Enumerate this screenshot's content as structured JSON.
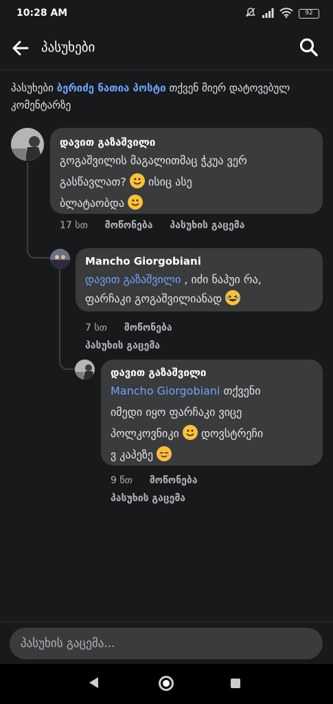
{
  "status_bar": {
    "time": "10:28 AM",
    "battery": "92"
  },
  "header": {
    "title": "პასუხები"
  },
  "intro": {
    "prefix": "პასუხები ",
    "link": "ბერიძე ნათია პოსტი",
    "suffix": " თქვენ მიერ დატოვებულ კომენტარზე"
  },
  "comments": [
    {
      "author": "დავით გაზაშვილი",
      "line1": "გოგაშვილის მაგალითმაც ჭკუა ვერ",
      "line2": "გასწავლათ?",
      "line2b": " ისიც ასე",
      "line3": "ბლატაობდა",
      "time": "17 სთ",
      "like": "მოწონება",
      "reply": "პასუხის გაცემა"
    },
    {
      "author": "Mancho Giorgobiani",
      "mention": "დავით გაზაშვილი",
      "line1_rest": " , იძი ნაჰუი რა,",
      "line2": "ფარჩაკი გოგაშვილიანად",
      "time": "7 სთ",
      "like": "მოწონება",
      "reply": "პასუხის გაცემა"
    },
    {
      "author": "დავით გაზაშვილი",
      "mention": "Mancho Giorgobiani",
      "line1_rest": "   თქვენი",
      "line2": "იმედი იყო ფარჩაკი  ვიცე",
      "line3": "პოლკოვნიკი",
      "line3b": " დოვსტრეჩი",
      "line4": "ვ კაპეზე",
      "time": "9 წთ",
      "like": "მოწონება",
      "reply": "პასუხის გაცემა"
    }
  ],
  "composer": {
    "placeholder": "პასუხის გაცემა..."
  },
  "colors": {
    "background": "#18191a",
    "bubble": "#3a3b3c",
    "link": "#6ea4ff"
  }
}
